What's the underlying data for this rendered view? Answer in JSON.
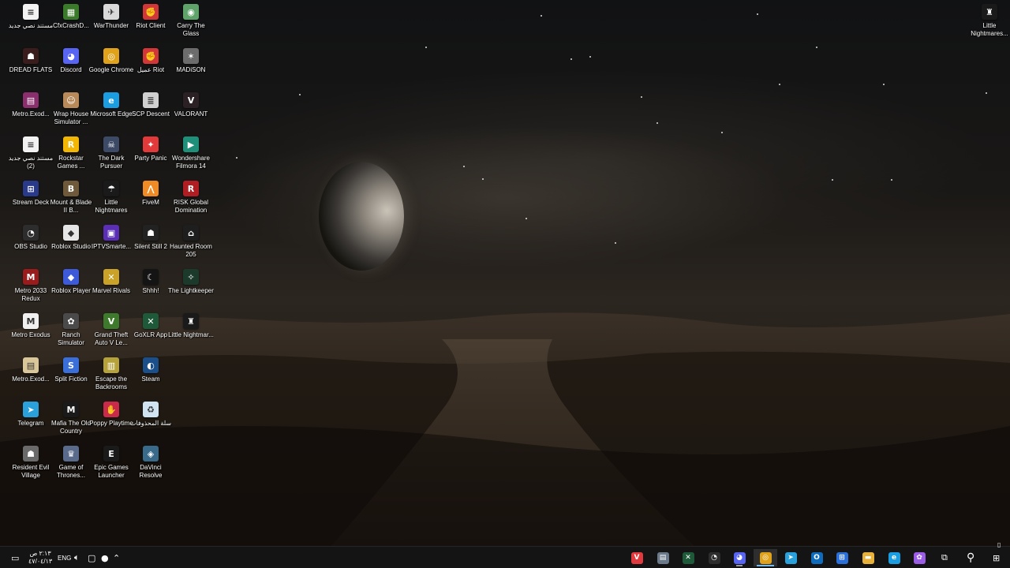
{
  "desktop": {
    "icons": [
      {
        "label": "مستند نصي جديد",
        "icon": "text-document-icon",
        "color": "#f2f2f2",
        "glyph": "≡",
        "col": 0,
        "row": 0
      },
      {
        "label": "CfxCrashD...",
        "icon": "cfx-icon",
        "color": "#3b7a2a",
        "glyph": "▦",
        "col": 1,
        "row": 0
      },
      {
        "label": "WarThunder",
        "icon": "warthunder-icon",
        "color": "#d9d9d9",
        "glyph": "✈",
        "col": 2,
        "row": 0
      },
      {
        "label": "Riot Client",
        "icon": "riot-client-icon",
        "color": "#d13639",
        "glyph": "✊",
        "col": 3,
        "row": 0
      },
      {
        "label": "Carry The Glass",
        "icon": "carry-the-glass-icon",
        "color": "#5fa36b",
        "glyph": "◉",
        "col": 4,
        "row": 0
      },
      {
        "label": "DREAD FLATS",
        "icon": "dread-flats-icon",
        "color": "#3a1c1c",
        "glyph": "☗",
        "col": 0,
        "row": 1
      },
      {
        "label": "Discord",
        "icon": "discord-icon",
        "color": "#5865f2",
        "glyph": "◕",
        "col": 1,
        "row": 1
      },
      {
        "label": "Google Chrome",
        "icon": "chrome-icon",
        "color": "#e0a21b",
        "glyph": "◎",
        "col": 2,
        "row": 1
      },
      {
        "label": "عميل Riot",
        "icon": "riot-client-ar-icon",
        "color": "#d13639",
        "glyph": "✊",
        "col": 3,
        "row": 1
      },
      {
        "label": "MADiSON",
        "icon": "madison-icon",
        "color": "#6c6c6c",
        "glyph": "✶",
        "col": 4,
        "row": 1
      },
      {
        "label": "Metro.Exod...",
        "icon": "archive-icon",
        "color": "#8a2e6e",
        "glyph": "▤",
        "col": 0,
        "row": 2
      },
      {
        "label": "Wrap House Simulator ...",
        "icon": "wrap-house-icon",
        "color": "#b88a5a",
        "glyph": "☺",
        "col": 1,
        "row": 2
      },
      {
        "label": "Microsoft Edge",
        "icon": "edge-icon",
        "color": "#1b9de2",
        "glyph": "e",
        "col": 2,
        "row": 2
      },
      {
        "label": "SCP Descent",
        "icon": "scp-descent-icon",
        "color": "#cfcfcf",
        "glyph": "≣",
        "col": 3,
        "row": 2
      },
      {
        "label": "VALORANT",
        "icon": "valorant-icon",
        "color": "#2b2024",
        "glyph": "V",
        "col": 4,
        "row": 2
      },
      {
        "label": "مستند نصي جديد (2)",
        "icon": "text-document-icon",
        "color": "#f2f2f2",
        "glyph": "≡",
        "col": 0,
        "row": 3
      },
      {
        "label": "Rockstar Games ...",
        "icon": "rockstar-icon",
        "color": "#f2b705",
        "glyph": "R",
        "col": 1,
        "row": 3
      },
      {
        "label": "The Dark Pursuer",
        "icon": "dark-pursuer-icon",
        "color": "#3c4a66",
        "glyph": "☠",
        "col": 2,
        "row": 3
      },
      {
        "label": "Party Panic",
        "icon": "party-panic-icon",
        "color": "#e23a3a",
        "glyph": "✦",
        "col": 3,
        "row": 3
      },
      {
        "label": "Wondershare Filmora 14",
        "icon": "filmora-icon",
        "color": "#1f8f7a",
        "glyph": "▶",
        "col": 4,
        "row": 3
      },
      {
        "label": "Stream Deck",
        "icon": "stream-deck-icon",
        "color": "#2a3a8a",
        "glyph": "⊞",
        "col": 0,
        "row": 4
      },
      {
        "label": "Mount & Blade II B...",
        "icon": "bannerlord-icon",
        "color": "#6e5a3a",
        "glyph": "B",
        "col": 1,
        "row": 4
      },
      {
        "label": "Little Nightmares",
        "icon": "little-nightmares-icon",
        "color": "#1a1a1a",
        "glyph": "☂",
        "col": 2,
        "row": 4
      },
      {
        "label": "FiveM",
        "icon": "fivem-icon",
        "color": "#f08a24",
        "glyph": "⋀",
        "col": 3,
        "row": 4
      },
      {
        "label": "RISK Global Domination",
        "icon": "risk-icon",
        "color": "#b01e24",
        "glyph": "R",
        "col": 4,
        "row": 4
      },
      {
        "label": "OBS Studio",
        "icon": "obs-icon",
        "color": "#2d2d2d",
        "glyph": "◔",
        "col": 0,
        "row": 5
      },
      {
        "label": "Roblox Studio",
        "icon": "roblox-studio-icon",
        "color": "#e6e6e6",
        "glyph": "◆",
        "col": 1,
        "row": 5
      },
      {
        "label": "IPTVSmarte...",
        "icon": "iptv-icon",
        "color": "#5a2fb5",
        "glyph": "▣",
        "col": 2,
        "row": 5
      },
      {
        "label": "Silent Still 2",
        "icon": "silent-still-icon",
        "color": "#222222",
        "glyph": "☗",
        "col": 3,
        "row": 5
      },
      {
        "label": "Haunted Room  205",
        "icon": "haunted-room-icon",
        "color": "#1e1e1e",
        "glyph": "⌂",
        "col": 4,
        "row": 5
      },
      {
        "label": "Metro 2033 Redux",
        "icon": "metro-2033-icon",
        "color": "#9a1b1b",
        "glyph": "M",
        "col": 0,
        "row": 6
      },
      {
        "label": "Roblox Player",
        "icon": "roblox-player-icon",
        "color": "#3d5bd9",
        "glyph": "◆",
        "col": 1,
        "row": 6
      },
      {
        "label": "Marvel Rivals",
        "icon": "marvel-rivals-icon",
        "color": "#c9a227",
        "glyph": "✕",
        "col": 2,
        "row": 6
      },
      {
        "label": "Shhh!",
        "icon": "shhh-icon",
        "color": "#141414",
        "glyph": "☾",
        "col": 3,
        "row": 6
      },
      {
        "label": "The Lightkeeper",
        "icon": "lightkeeper-icon",
        "color": "#1c3a2c",
        "glyph": "✧",
        "col": 4,
        "row": 6
      },
      {
        "label": "Metro Exodus",
        "icon": "metro-exodus-icon",
        "color": "#f0f0f0",
        "glyph": "M",
        "col": 0,
        "row": 7
      },
      {
        "label": "Ranch Simulator",
        "icon": "ranch-simulator-icon",
        "color": "#4a4a4a",
        "glyph": "✿",
        "col": 1,
        "row": 7
      },
      {
        "label": "Grand Theft Auto V Le...",
        "icon": "gta-v-icon",
        "color": "#3d7a2b",
        "glyph": "V",
        "col": 2,
        "row": 7
      },
      {
        "label": "GoXLR App",
        "icon": "goxlr-icon",
        "color": "#1e5a3a",
        "glyph": "✕",
        "col": 3,
        "row": 7
      },
      {
        "label": "Little Nightmar...",
        "icon": "little-nightmares-2-icon",
        "color": "#1a1a1a",
        "glyph": "♜",
        "col": 4,
        "row": 7
      },
      {
        "label": "Metro.Exod...",
        "icon": "archive-2-icon",
        "color": "#d9c79a",
        "glyph": "▤",
        "col": 0,
        "row": 8
      },
      {
        "label": "Split Fiction",
        "icon": "split-fiction-icon",
        "color": "#3a6fd9",
        "glyph": "S",
        "col": 1,
        "row": 8
      },
      {
        "label": "Escape the Backrooms",
        "icon": "escape-backrooms-icon",
        "color": "#b5a23a",
        "glyph": "▥",
        "col": 2,
        "row": 8
      },
      {
        "label": "Steam",
        "icon": "steam-icon",
        "color": "#1b4f8a",
        "glyph": "◐",
        "col": 3,
        "row": 8
      },
      {
        "label": "Telegram",
        "icon": "telegram-icon",
        "color": "#2aa1da",
        "glyph": "➤",
        "col": 0,
        "row": 9
      },
      {
        "label": "Mafia The Old Country",
        "icon": "mafia-icon",
        "color": "#1a1a1a",
        "glyph": "M",
        "col": 1,
        "row": 9
      },
      {
        "label": "Poppy Playtime",
        "icon": "poppy-playtime-icon",
        "color": "#c92a4a",
        "glyph": "✋",
        "col": 2,
        "row": 9
      },
      {
        "label": "سلة المحذوفات",
        "icon": "recycle-bin-icon",
        "color": "#cfe3f2",
        "glyph": "♻",
        "col": 3,
        "row": 9
      },
      {
        "label": "Resident Evil Village",
        "icon": "resident-evil-icon",
        "color": "#6a6a6a",
        "glyph": "☗",
        "col": 0,
        "row": 10
      },
      {
        "label": "Game of Thrones...",
        "icon": "game-of-thrones-icon",
        "color": "#5a6a8a",
        "glyph": "♛",
        "col": 1,
        "row": 10
      },
      {
        "label": "Epic Games Launcher",
        "icon": "epic-games-icon",
        "color": "#1a1a1a",
        "glyph": "E",
        "col": 2,
        "row": 10
      },
      {
        "label": "DaVinci Resolve",
        "icon": "davinci-icon",
        "color": "#3a6a8a",
        "glyph": "◈",
        "col": 3,
        "row": 10
      }
    ],
    "right_icon": {
      "label": "Little Nightmares...",
      "icon": "little-nightmares-3-icon",
      "color": "#1a1a1a",
      "glyph": "♜"
    }
  },
  "taskbar": {
    "clock": {
      "time": "٢:١٣ ص",
      "date": "٤٧/٠٤/١٣"
    },
    "language": "ENG",
    "apps": [
      {
        "name": "vivaldi-taskbar",
        "icon": "vivaldi-icon",
        "color": "#e03a3e",
        "glyph": "V",
        "state": "none"
      },
      {
        "name": "file-explorer-taskbar-2",
        "icon": "folder-stack-icon",
        "color": "#6a7a8a",
        "glyph": "▤",
        "state": "none"
      },
      {
        "name": "goxlr-taskbar",
        "icon": "goxlr-icon",
        "color": "#1e5a3a",
        "glyph": "✕",
        "state": "none"
      },
      {
        "name": "obs-taskbar",
        "icon": "obs-icon",
        "color": "#2d2d2d",
        "glyph": "◔",
        "state": "none"
      },
      {
        "name": "discord-taskbar",
        "icon": "discord-icon",
        "color": "#5865f2",
        "glyph": "◕",
        "state": "open"
      },
      {
        "name": "chrome-taskbar",
        "icon": "chrome-icon",
        "color": "#e0a21b",
        "glyph": "◎",
        "state": "active"
      },
      {
        "name": "telegram-taskbar",
        "icon": "telegram-icon",
        "color": "#2aa1da",
        "glyph": "➤",
        "state": "none"
      },
      {
        "name": "outlook-taskbar",
        "icon": "outlook-icon",
        "color": "#0f6cbd",
        "glyph": "O",
        "state": "none"
      },
      {
        "name": "store-taskbar",
        "icon": "store-icon",
        "color": "#2b6fd9",
        "glyph": "⊞",
        "state": "none"
      },
      {
        "name": "file-explorer-taskbar",
        "icon": "folder-icon",
        "color": "#e8b23a",
        "glyph": "▬",
        "state": "none"
      },
      {
        "name": "edge-taskbar",
        "icon": "edge-icon",
        "color": "#1b9de2",
        "glyph": "e",
        "state": "none"
      },
      {
        "name": "copilot-taskbar",
        "icon": "copilot-icon",
        "color": "#9b5de5",
        "glyph": "✿",
        "state": "none"
      }
    ]
  }
}
